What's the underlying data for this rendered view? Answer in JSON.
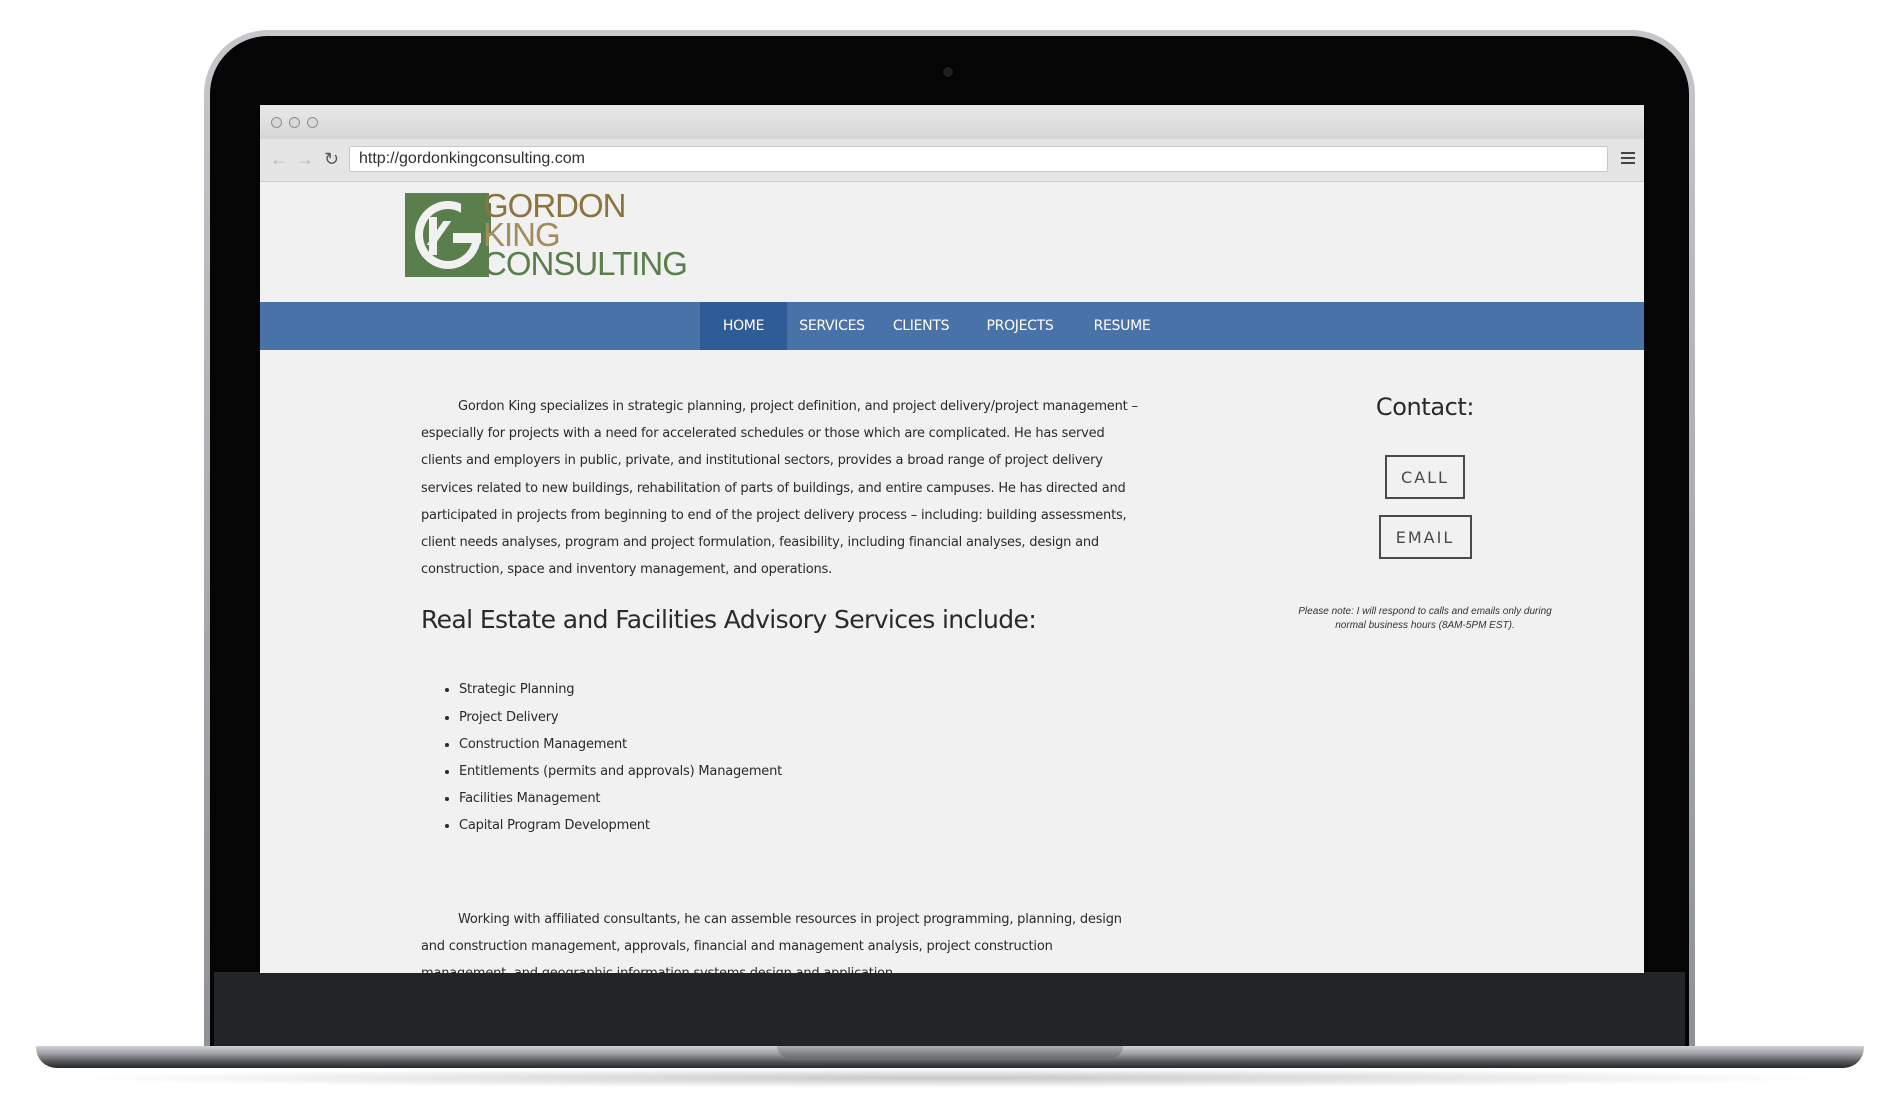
{
  "browser": {
    "url": "http://gordonkingconsulting.com",
    "back_icon": "arrow-left-icon",
    "forward_icon": "arrow-right-icon",
    "reload_icon": "reload-icon",
    "menu_icon": "hamburger-menu-icon"
  },
  "logo": {
    "line1": "GORDON",
    "line2": "KING",
    "line3": "CONSULTING",
    "colors": {
      "green": "#5a7f4c",
      "gold": "#8c7440"
    }
  },
  "nav": {
    "items": [
      {
        "label": "HOME",
        "active": true
      },
      {
        "label": "SERVICES",
        "active": false
      },
      {
        "label": "CLIENTS",
        "active": false
      },
      {
        "label": "PROJECTS",
        "active": false
      },
      {
        "label": "RESUME",
        "active": false
      }
    ],
    "bar_color": "#4872a8",
    "active_color": "#2f5c97"
  },
  "main": {
    "intro": "Gordon King specializes in strategic planning, project definition, and project delivery/project management – especially for projects with a need for accelerated schedules or those which are complicated. He has served clients and employers in public, private, and institutional sectors, provides a broad range of project delivery services related to new buildings, rehabilitation of parts of buildings, and entire campuses. He has directed and participated in projects from beginning to end of the project delivery process – including: building assessments, client needs analyses, program and project formulation, feasibility, including financial analyses, design and construction, space and inventory management, and operations.",
    "services_heading": "Real Estate and Facilities Advisory Services include:",
    "services": [
      "Strategic Planning",
      "Project Delivery",
      "Construction Management",
      "Entitlements (permits and approvals) Management",
      "Facilities Management",
      "Capital Program Development"
    ],
    "closing": "Working with affiliated consultants, he can assemble resources in project programming, planning, design and construction management, approvals, financial and management analysis, project construction management, and geographic information systems design and application."
  },
  "contact": {
    "title": "Contact:",
    "call_label": "CALL",
    "email_label": "EMAIL",
    "note": "Please note: I will respond to calls and emails only during normal business hours (8AM-5PM EST)."
  }
}
